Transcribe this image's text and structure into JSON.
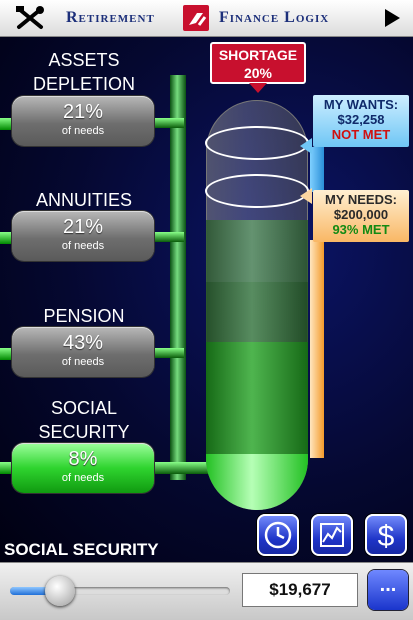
{
  "header": {
    "logo_left": "Retirement",
    "logo_right": "Finance Logix",
    "tools_icon": "tools-icon",
    "play_icon": "play-icon"
  },
  "sources": [
    {
      "label_line1": "ASSETS",
      "label_line2": "DEPLETION",
      "percent": "21%",
      "sub": "of needs",
      "active": false
    },
    {
      "label_line1": "ANNUITIES",
      "label_line2": "",
      "percent": "21%",
      "sub": "of needs",
      "active": false
    },
    {
      "label_line1": "PENSION",
      "label_line2": "",
      "percent": "43%",
      "sub": "of needs",
      "active": false
    },
    {
      "label_line1": "SOCIAL",
      "label_line2": "SECURITY",
      "percent": "8%",
      "sub": "of needs",
      "active": true
    }
  ],
  "shortage": {
    "label": "SHORTAGE",
    "percent": "20%"
  },
  "wants": {
    "label": "MY WANTS:",
    "amount": "$32,258",
    "status": "NOT MET"
  },
  "needs": {
    "label": "MY NEEDS:",
    "amount": "$200,000",
    "status": "93% MET"
  },
  "section_title": "SOCIAL SECURITY",
  "tool_buttons": [
    "clock-icon",
    "chart-icon",
    "dollar-icon"
  ],
  "slider": {
    "value_fraction": 0.2
  },
  "amount_box": "$19,677",
  "more_button": "...",
  "colors": {
    "accent": "#1f35c8",
    "shortage": "#c8102e",
    "met": "#138a13",
    "not_met": "#d01010"
  }
}
